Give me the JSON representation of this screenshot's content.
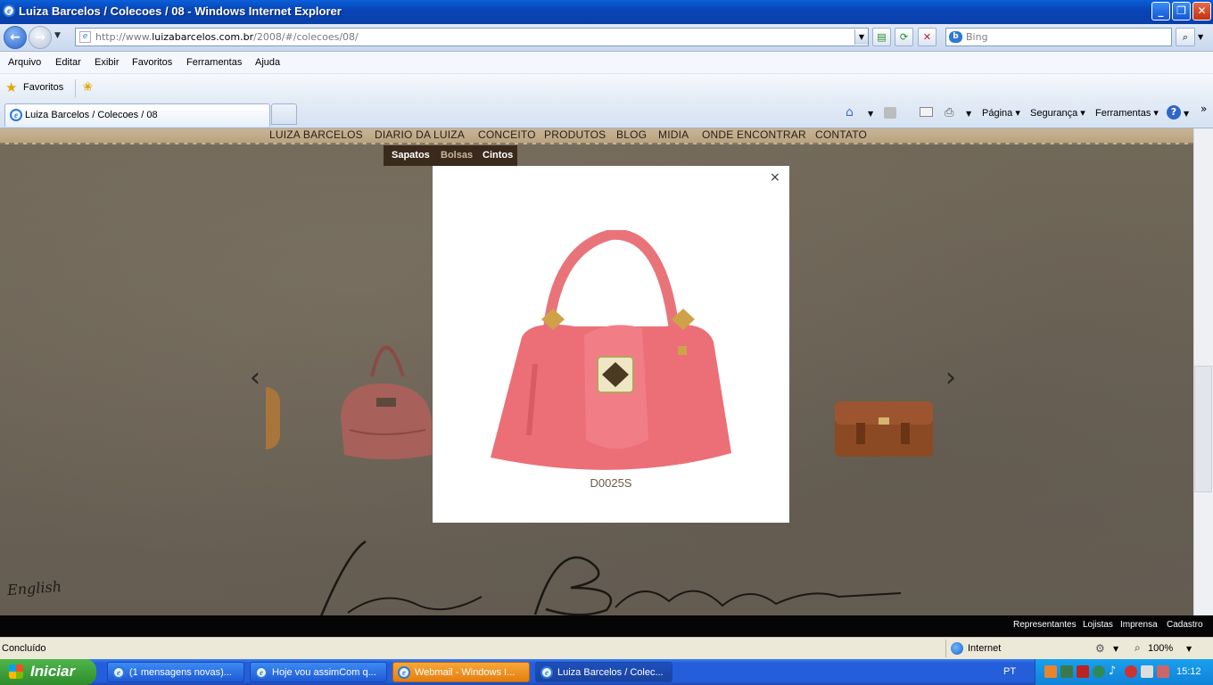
{
  "window": {
    "title": "Luiza Barcelos / Colecoes / 08 - Windows Internet Explorer"
  },
  "address": {
    "url_prefix": "http://www.",
    "url_domain": "luizabarcelos.com.br",
    "url_rest": "/2008/#/colecoes/08/"
  },
  "search": {
    "placeholder": "Bing"
  },
  "menu": [
    "Arquivo",
    "Editar",
    "Exibir",
    "Favoritos",
    "Ferramentas",
    "Ajuda"
  ],
  "favorites": {
    "label": "Favoritos"
  },
  "tab": {
    "label": "Luiza Barcelos / Colecoes / 08"
  },
  "commandbar": {
    "page": "Página",
    "security": "Segurança",
    "tools": "Ferramentas"
  },
  "site": {
    "nav": [
      "LUIZA BARCELOS",
      "DIARIO DA LUIZA",
      "CONCEITO",
      "PRODUTOS",
      "BLOG",
      "MIDIA",
      "ONDE ENCONTRAR",
      "CONTATO"
    ],
    "subnav": [
      "Sapatos",
      "Bolsas",
      "Cintos"
    ],
    "english_link": "English",
    "logo_signature": "Luiza Barcelos",
    "footer_links": [
      "Representantes",
      "Lojistas",
      "Imprensa",
      "Cadastro"
    ],
    "colors": {
      "subnav_active": "#c8b59a",
      "subnav_text": "#ffffff",
      "bag": "#e86b72"
    }
  },
  "modal": {
    "close": "×",
    "product_code": "D0025S"
  },
  "status": {
    "text": "Concluído",
    "zone": "Internet",
    "zoom": "100%"
  },
  "taskbar": {
    "start": "Iniciar",
    "items": [
      "(1 mensagens novas)...",
      "Hoje vou assimCom q...",
      "Webmail - Windows I...",
      "Luiza Barcelos / Colec..."
    ],
    "lang": "PT",
    "clock": "15:12"
  }
}
